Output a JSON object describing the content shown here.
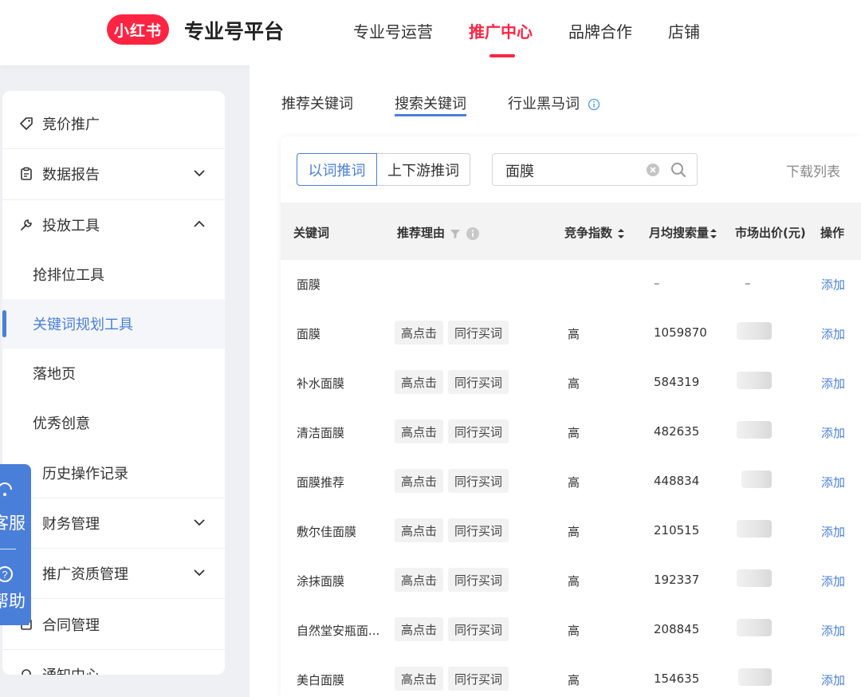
{
  "header": {
    "logo_text": "小红书",
    "title": "专业号平台",
    "nav": [
      "专业号运营",
      "推广中心",
      "品牌合作",
      "店铺"
    ],
    "active_nav": "推广中心"
  },
  "sidebar": {
    "items": [
      {
        "label": "竞价推广",
        "icon": "tag-icon"
      },
      {
        "label": "数据报告",
        "icon": "clipboard-icon",
        "chevron": "down"
      },
      {
        "label": "投放工具",
        "icon": "wrench-icon",
        "chevron": "up"
      },
      {
        "label": "抢排位工具"
      },
      {
        "label": "关键词规划工具",
        "active": true
      },
      {
        "label": "落地页"
      },
      {
        "label": "优秀创意"
      },
      {
        "label": "历史操作记录",
        "icon": "history-icon"
      },
      {
        "label": "财务管理",
        "icon": "wallet-icon",
        "chevron": "down"
      },
      {
        "label": "推广资质管理",
        "icon": "certificate-icon",
        "chevron": "down"
      },
      {
        "label": "合同管理",
        "icon": "contract-icon"
      },
      {
        "label": "通知中心",
        "icon": "bell-icon"
      }
    ]
  },
  "float_tab": {
    "service": "客服",
    "help": "帮助"
  },
  "tabs": [
    "推荐关键词",
    "搜索关键词",
    "行业黑马词"
  ],
  "active_tab": "搜索关键词",
  "toolbar": {
    "seg_left": "以词推词",
    "seg_right": "上下游推词",
    "search_value": "面膜",
    "download": "下载列表"
  },
  "table": {
    "headers": [
      "关键词",
      "推荐理由",
      "竞争指数",
      "月均搜索量",
      "市场出价(元)",
      "操作"
    ],
    "rows": [
      {
        "keyword": "面膜",
        "tags": [],
        "competition": "",
        "volume": "–",
        "price": "–",
        "action": "添加"
      },
      {
        "keyword": "面膜",
        "tags": [
          "高点击",
          "同行买词"
        ],
        "competition": "高",
        "volume": "1059870",
        "price": "",
        "action": "添加"
      },
      {
        "keyword": "补水面膜",
        "tags": [
          "高点击",
          "同行买词"
        ],
        "competition": "高",
        "volume": "584319",
        "price": "",
        "action": "添加"
      },
      {
        "keyword": "清洁面膜",
        "tags": [
          "高点击",
          "同行买词"
        ],
        "competition": "高",
        "volume": "482635",
        "price": "",
        "action": "添加"
      },
      {
        "keyword": "面膜推荐",
        "tags": [
          "高点击",
          "同行买词"
        ],
        "competition": "高",
        "volume": "448834",
        "price": "",
        "action": "添加"
      },
      {
        "keyword": "敷尔佳面膜",
        "tags": [
          "高点击",
          "同行买词"
        ],
        "competition": "高",
        "volume": "210515",
        "price": "",
        "action": "添加"
      },
      {
        "keyword": "涂抹面膜",
        "tags": [
          "高点击",
          "同行买词"
        ],
        "competition": "高",
        "volume": "192337",
        "price": "",
        "action": "添加"
      },
      {
        "keyword": "自然堂安瓶面...",
        "tags": [
          "高点击",
          "同行买词"
        ],
        "competition": "高",
        "volume": "208845",
        "price": "",
        "action": "添加"
      },
      {
        "keyword": "美白面膜",
        "tags": [
          "高点击",
          "同行买词"
        ],
        "competition": "高",
        "volume": "154635",
        "price": "",
        "action": "添加"
      }
    ]
  },
  "colors": {
    "brand_red": "#ff2442",
    "accent_blue": "#4a7fd9"
  }
}
